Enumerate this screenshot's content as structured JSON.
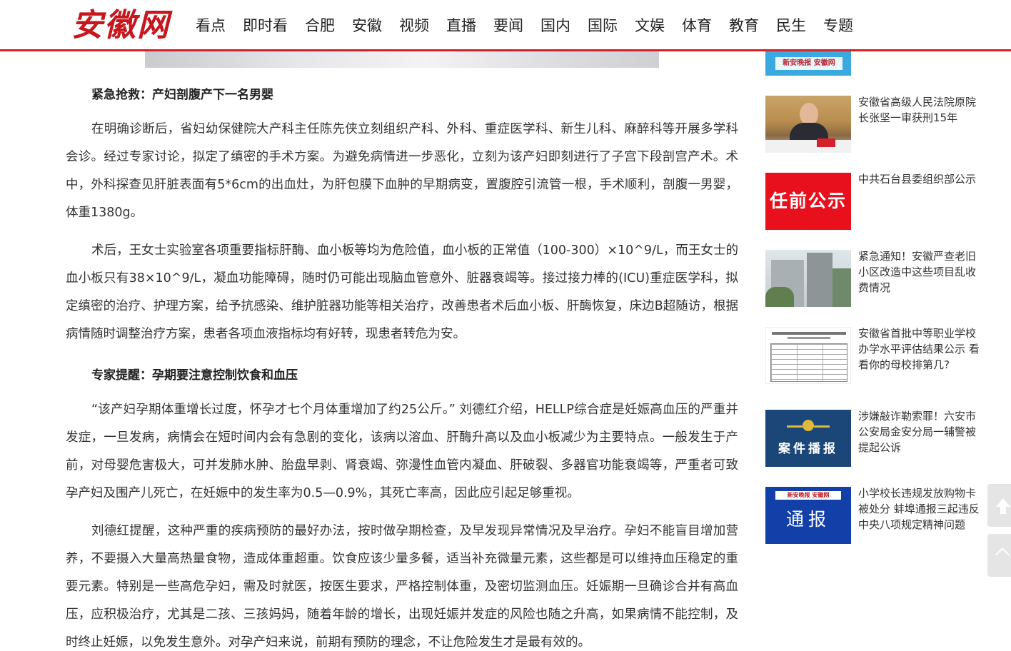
{
  "header": {
    "logo_text": "安徽网",
    "nav": [
      "看点",
      "即时看",
      "合肥",
      "安徽",
      "视频",
      "直播",
      "要闻",
      "国内",
      "国际",
      "文娱",
      "体育",
      "教育",
      "民生",
      "专题"
    ]
  },
  "article": {
    "heading1": "紧急抢救：产妇剖腹产下一名男婴",
    "p1": "在明确诊断后，省妇幼保健院大产科主任陈先侠立刻组织产科、外科、重症医学科、新生儿科、麻醉科等开展多学科会诊。经过专家讨论，拟定了缜密的手术方案。为避免病情进一步恶化，立刻为该产妇即刻进行了子宫下段剖宫产术。术中，外科探查见肝脏表面有5*6cm的出血灶，为肝包膜下血肿的早期病变，置腹腔引流管一根，手术顺利，剖腹一男婴，体重1380g。",
    "p2": "术后，王女士实验室各项重要指标肝酶、血小板等均为危险值，血小板的正常值（100-300）×10^9/L，而王女士的血小板只有38×10^9/L，凝血功能障碍，随时仍可能出现脑血管意外、脏器衰竭等。接过接力棒的(ICU)重症医学科，拟定缜密的治疗、护理方案，给予抗感染、维护脏器功能等相关治疗，改善患者术后血小板、肝酶恢复，床边B超随访，根据病情随时调整治疗方案，患者各项血液指标均有好转，现患者转危为安。",
    "heading2": "专家提醒：孕期要注意控制饮食和血压",
    "p3": "“该产妇孕期体重增长过度，怀孕才七个月体重增加了约25公斤。” 刘德红介绍，HELLP综合症是妊娠高血压的严重并发症，一旦发病，病情会在短时间内会有急剧的变化，该病以溶血、肝酶升高以及血小板减少为主要特点。一般发生于产前，对母婴危害极大，可并发肺水肿、胎盘早剥、肾衰竭、弥漫性血管内凝血、肝破裂、多器官功能衰竭等，严重者可致孕产妇及围产儿死亡，在妊娠中的发生率为0.5—0.9%，其死亡率高，因此应引起足够重视。",
    "p4": "刘德红提醒，这种严重的疾病预防的最好办法，按时做孕期检查，及早发现异常情况及早治疗。孕妇不能盲目增加营养，不要摄入大量高热量食物，造成体重超重。饮食应该少量多餐，适当补充微量元素，这些都是可以维持血压稳定的重要元素。特别是一些高危孕妇，需及时就医，按医生要求，严格控制体重，及密切监测血压。妊娠期一旦确诊合并有高血压，应积极治疗，尤其是二孩、三孩妈妈，随着年龄的增长，出现妊娠并发症的风险也随之升高，如果病情不能控制，及时终止妊娠，以免发生意外。对孕产妇来说，前期有预防的理念，不让危险发生才是最有效的。"
  },
  "sidebar": {
    "top_thumb_band": "新安晚报 安徽网",
    "items": [
      {
        "text": "安徽省高级人民法院原院长张坚一审获刑15年",
        "thumb": "person"
      },
      {
        "text": "中共石台县委组织部公示",
        "thumb": "red",
        "thumb_label": "任前公示"
      },
      {
        "text": "紧急通知！安徽严查老旧小区改造中这些项目乱收费情况",
        "thumb": "building"
      },
      {
        "text": "安徽省首批中等职业学校办学水平评估结果公示 看看你的母校排第几?",
        "thumb": "doc"
      },
      {
        "text": "涉嫌敲诈勒索罪！六安市公安局金安分局一辅警被提起公诉",
        "thumb": "navy",
        "thumb_label": "案件播报"
      },
      {
        "text": "小学校长违规发放购物卡被处分 蚌埠通报三起违反中央八项规定精神问题",
        "thumb": "blue",
        "thumb_label": "通报",
        "thumb_band": "新安晚报 安徽网"
      }
    ]
  },
  "colors": {
    "brand_red": "#d6202a",
    "logo_red": "#c8161d"
  },
  "icons": {
    "back_to_top": "arrow-up-icon",
    "scroll_up": "chevron-up-icon"
  }
}
